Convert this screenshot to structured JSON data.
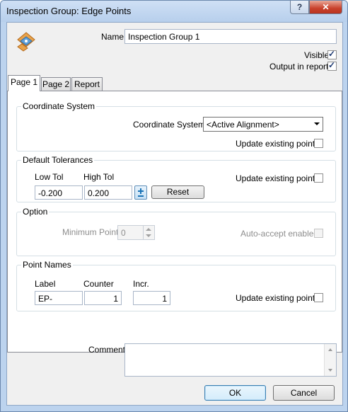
{
  "window": {
    "title": "Inspection Group: Edge Points",
    "help_label": "?",
    "close_label": "✕"
  },
  "header": {
    "icon": "inspection-group-icon",
    "name_label": "Name",
    "name_value": "Inspection Group 1",
    "visible_label": "Visible",
    "visible_checked": true,
    "output_label": "Output in report",
    "output_checked": true
  },
  "tabs": [
    {
      "label": "Page 1",
      "active": true
    },
    {
      "label": "Page 2",
      "active": false
    },
    {
      "label": "Report",
      "active": false
    }
  ],
  "coordinate_system": {
    "group_title": "Coordinate System",
    "label": "Coordinate System",
    "selected": "<Active Alignment>",
    "update_label": "Update existing points",
    "update_checked": false
  },
  "default_tolerances": {
    "group_title": "Default Tolerances",
    "low_label": "Low Tol",
    "high_label": "High Tol",
    "low_value": "-0.200",
    "high_value": "0.200",
    "sync_icon": "plus-minus-icon",
    "reset_label": "Reset",
    "update_label": "Update existing points",
    "update_checked": false
  },
  "option": {
    "group_title": "Option",
    "min_points_label": "Minimum Points",
    "min_points_value": "0",
    "auto_accept_label": "Auto-accept enabled",
    "auto_accept_checked": false
  },
  "point_names": {
    "group_title": "Point Names",
    "label_header": "Label",
    "counter_header": "Counter",
    "incr_header": "Incr.",
    "label_value": "EP-",
    "counter_value": "1",
    "incr_value": "1",
    "update_label": "Update existing points",
    "update_checked": false
  },
  "comment": {
    "label": "Comment",
    "value": ""
  },
  "footer": {
    "ok_label": "OK",
    "cancel_label": "Cancel"
  }
}
